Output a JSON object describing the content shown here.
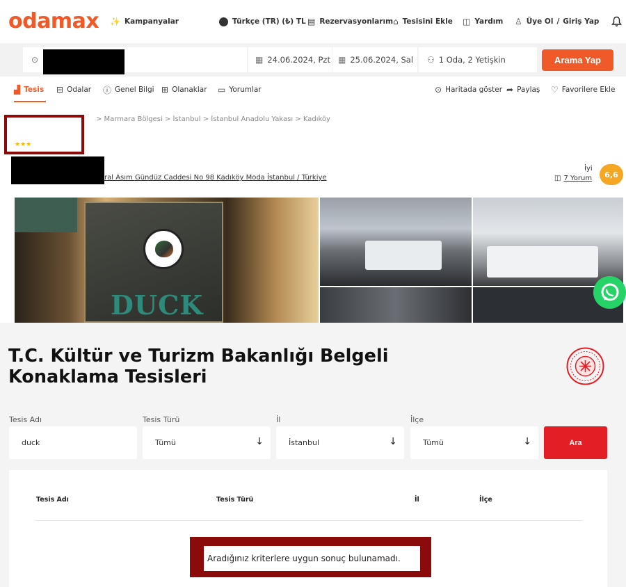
{
  "header": {
    "logo": "odamax",
    "campaigns": "Kampanyalar",
    "language": "Türkçe (TR) (₺) TL",
    "reservations": "Rezervasyonlarım",
    "add_property": "Tesisini Ekle",
    "help": "Yardım",
    "signup": "Üye Ol",
    "separator": "/",
    "login": "Giriş Yap"
  },
  "search": {
    "checkin": "24.06.2024, Pzt",
    "checkout": "25.06.2024, Sal",
    "guests": "1 Oda, 2 Yetişkin",
    "button": "Arama Yap"
  },
  "tabs": {
    "property": "Tesis",
    "rooms": "Odalar",
    "general": "Genel Bilgi",
    "facilities": "Olanaklar",
    "reviews": "Yorumlar",
    "map": "Haritada göster",
    "share": "Paylaş",
    "favorites": "Favorilere Ekle"
  },
  "hotel": {
    "breadcrumb": "> Marmara Bölgesi  >  İstanbul  >  İstanbul Anadolu Yakası  >  Kadıköy",
    "stars": "★★★",
    "address": "ral Asım Gündüz Caddesi No 98 Kadıköy Moda İstanbul / Türkiye",
    "rating_label": "İyi",
    "review_count": "7 Yorum",
    "score": "6,6",
    "sign_text": "DUCK"
  },
  "ministry": {
    "title_line1": "T.C. Kültür ve Turizm Bakanlığı Belgeli",
    "title_line2": "Konaklama Tesisleri",
    "filters": {
      "name_label": "Tesis Adı",
      "name_value": "duck",
      "type_label": "Tesis Türü",
      "type_value": "Tümü",
      "city_label": "İl",
      "city_value": "İstanbul",
      "district_label": "İlçe",
      "district_value": "Tümü",
      "search_button": "Ara"
    },
    "table_headers": [
      "Tesis Adı",
      "Tesis Türü",
      "İl",
      "İlçe"
    ],
    "no_result": "Aradığınız kriterlere uygun sonuç bulunamadı."
  },
  "colors": {
    "brand": "#f05a28",
    "highlight": "#8b0a0a",
    "ara": "#e31e24",
    "score": "#f5a623"
  }
}
